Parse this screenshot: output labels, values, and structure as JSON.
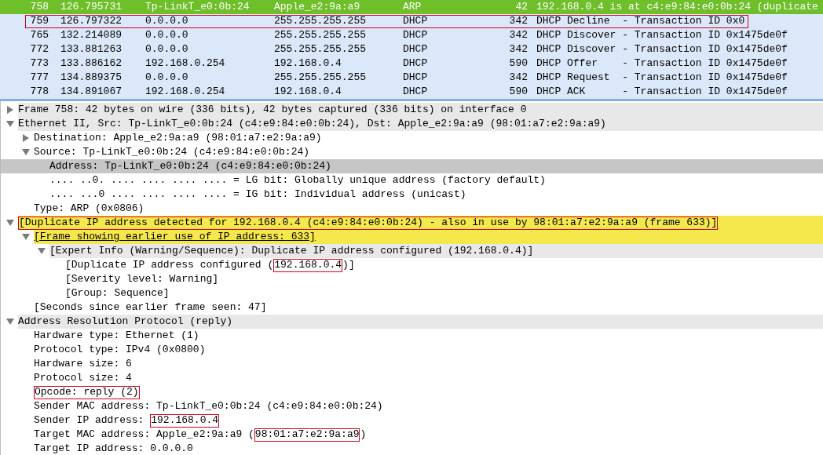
{
  "packet_list": {
    "rows": [
      {
        "no": "758",
        "time": "126.795731",
        "source": "Tp-LinkT_e0:0b:24",
        "destination": "Apple_e2:9a:a9",
        "protocol": "ARP",
        "length": "42",
        "info": "192.168.0.4 is at c4:e9:84:e0:0b:24 (duplicate",
        "selected": true,
        "boxed": false
      },
      {
        "no": "759",
        "time": "126.797322",
        "source": "0.0.0.0",
        "destination": "255.255.255.255",
        "protocol": "DHCP",
        "length": "342",
        "info": "DHCP Decline  - Transaction ID 0x0",
        "selected": false,
        "boxed": true
      },
      {
        "no": "765",
        "time": "132.214089",
        "source": "0.0.0.0",
        "destination": "255.255.255.255",
        "protocol": "DHCP",
        "length": "342",
        "info": "DHCP Discover - Transaction ID 0x1475de0f",
        "selected": false,
        "boxed": false
      },
      {
        "no": "772",
        "time": "133.881263",
        "source": "0.0.0.0",
        "destination": "255.255.255.255",
        "protocol": "DHCP",
        "length": "342",
        "info": "DHCP Discover - Transaction ID 0x1475de0f",
        "selected": false,
        "boxed": false
      },
      {
        "no": "773",
        "time": "133.886162",
        "source": "192.168.0.254",
        "destination": "192.168.0.4",
        "protocol": "DHCP",
        "length": "590",
        "info": "DHCP Offer    - Transaction ID 0x1475de0f",
        "selected": false,
        "boxed": false
      },
      {
        "no": "777",
        "time": "134.889375",
        "source": "0.0.0.0",
        "destination": "255.255.255.255",
        "protocol": "DHCP",
        "length": "342",
        "info": "DHCP Request  - Transaction ID 0x1475de0f",
        "selected": false,
        "boxed": false
      },
      {
        "no": "778",
        "time": "134.891067",
        "source": "192.168.0.254",
        "destination": "192.168.0.4",
        "protocol": "DHCP",
        "length": "590",
        "info": "DHCP ACK      - Transaction ID 0x1475de0f",
        "selected": false,
        "boxed": false
      }
    ]
  },
  "packet_details": [
    {
      "kind": "section",
      "selected": false,
      "expanded": false,
      "segments": [
        {
          "text": "Frame 758: 42 bytes on wire (336 bits), 42 bytes captured (336 bits) on interface 0",
          "boxed": false
        }
      ]
    },
    {
      "kind": "section",
      "selected": false,
      "expanded": true,
      "segments": [
        {
          "text": "Ethernet II, Src: Tp-LinkT_e0:0b:24 (c4:e9:84:e0:0b:24), Dst: Apple_e2:9a:a9 (98:01:a7:e2:9a:a9)",
          "boxed": false
        }
      ],
      "children": [
        {
          "kind": "field",
          "selected": false,
          "expanded": false,
          "segments": [
            {
              "text": "Destination: Apple_e2:9a:a9 (98:01:a7:e2:9a:a9)",
              "boxed": false
            }
          ]
        },
        {
          "kind": "field",
          "selected": false,
          "expanded": true,
          "segments": [
            {
              "text": "Source: Tp-LinkT_e0:0b:24 (c4:e9:84:e0:0b:24)",
              "boxed": false
            }
          ],
          "children": [
            {
              "kind": "field",
              "selected": true,
              "segments": [
                {
                  "text": "Address: Tp-LinkT_e0:0b:24 (c4:e9:84:e0:0b:24)",
                  "boxed": false
                }
              ]
            },
            {
              "kind": "field",
              "selected": false,
              "segments": [
                {
                  "text": ".... ..0. .... .... .... .... = LG bit: Globally unique address (factory default)",
                  "boxed": false
                }
              ]
            },
            {
              "kind": "field",
              "selected": false,
              "segments": [
                {
                  "text": ".... ...0 .... .... .... .... = IG bit: Individual address (unicast)",
                  "boxed": false
                }
              ]
            }
          ]
        },
        {
          "kind": "field",
          "selected": false,
          "segments": [
            {
              "text": "Type: ARP (0x0806)",
              "boxed": false
            }
          ]
        }
      ]
    },
    {
      "kind": "warning",
      "selected": false,
      "expanded": true,
      "segments": [
        {
          "text": "[Duplicate IP address detected for 192.168.0.4 (c4:e9:84:e0:0b:24) - also in use by 98:01:a7:e2:9a:a9 (frame 633)]",
          "boxed": true
        }
      ],
      "children": [
        {
          "kind": "link",
          "selected": false,
          "expanded": true,
          "segments": [
            {
              "text": "[Frame showing earlier use of IP address: 633]",
              "boxed": false
            }
          ],
          "children": [
            {
              "kind": "section",
              "selected": false,
              "expanded": true,
              "segments": [
                {
                  "text": "[Expert Info (Warning/Sequence): Duplicate IP address configured (192.168.0.4)]",
                  "boxed": false
                }
              ],
              "children": [
                {
                  "kind": "field",
                  "selected": false,
                  "segments": [
                    {
                      "text": "[Duplicate IP address configured (",
                      "boxed": false
                    },
                    {
                      "text": "192.168.0.4",
                      "boxed": true
                    },
                    {
                      "text": ")]",
                      "boxed": false
                    }
                  ]
                },
                {
                  "kind": "field",
                  "selected": false,
                  "segments": [
                    {
                      "text": "[Severity level: Warning]",
                      "boxed": false
                    }
                  ]
                },
                {
                  "kind": "field",
                  "selected": false,
                  "segments": [
                    {
                      "text": "[Group: Sequence]",
                      "boxed": false
                    }
                  ]
                }
              ]
            }
          ]
        },
        {
          "kind": "field",
          "selected": false,
          "segments": [
            {
              "text": "[Seconds since earlier frame seen: 47]",
              "boxed": false
            }
          ]
        }
      ]
    },
    {
      "kind": "section",
      "selected": false,
      "expanded": true,
      "segments": [
        {
          "text": "Address Resolution Protocol (reply)",
          "boxed": false
        }
      ],
      "children": [
        {
          "kind": "field",
          "selected": false,
          "segments": [
            {
              "text": "Hardware type: Ethernet (1)",
              "boxed": false
            }
          ]
        },
        {
          "kind": "field",
          "selected": false,
          "segments": [
            {
              "text": "Protocol type: IPv4 (0x0800)",
              "boxed": false
            }
          ]
        },
        {
          "kind": "field",
          "selected": false,
          "segments": [
            {
              "text": "Hardware size: 6",
              "boxed": false
            }
          ]
        },
        {
          "kind": "field",
          "selected": false,
          "segments": [
            {
              "text": "Protocol size: 4",
              "boxed": false
            }
          ]
        },
        {
          "kind": "field",
          "selected": false,
          "segments": [
            {
              "text": "Opcode: reply (2)",
              "boxed": true
            }
          ]
        },
        {
          "kind": "field",
          "selected": false,
          "segments": [
            {
              "text": "Sender MAC address: Tp-LinkT_e0:0b:24 (c4:e9:84:e0:0b:24)",
              "boxed": false
            }
          ]
        },
        {
          "kind": "field",
          "selected": false,
          "segments": [
            {
              "text": "Sender IP address: ",
              "boxed": false
            },
            {
              "text": "192.168.0.4",
              "boxed": true
            }
          ]
        },
        {
          "kind": "field",
          "selected": false,
          "segments": [
            {
              "text": "Target MAC address: Apple_e2:9a:a9 (",
              "boxed": false
            },
            {
              "text": "98:01:a7:e2:9a:a9",
              "boxed": true
            },
            {
              "text": ")",
              "boxed": false
            }
          ]
        },
        {
          "kind": "field",
          "selected": false,
          "segments": [
            {
              "text": "Target IP address: 0.0.0.0",
              "boxed": false
            }
          ]
        }
      ]
    }
  ]
}
